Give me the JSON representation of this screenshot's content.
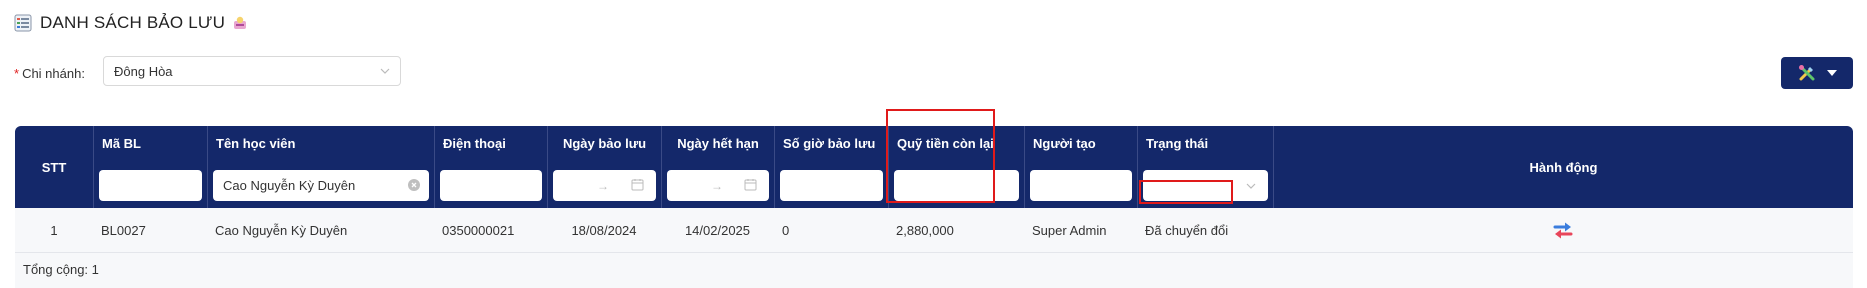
{
  "page": {
    "title": "DANH SÁCH BẢO LƯU"
  },
  "filter": {
    "required_mark": "*",
    "branch_label": "Chi nhánh:",
    "branch_value": "Đông Hòa"
  },
  "table": {
    "columns": {
      "stt": "STT",
      "code": "Mã BL",
      "student": "Tên học viên",
      "phone": "Điện thoại",
      "reserve_date": "Ngày bảo lưu",
      "expiry_date": "Ngày hết hạn",
      "hours": "Số giờ bảo lưu",
      "fund": "Quỹ tiền còn lại",
      "creator": "Người tạo",
      "status": "Trạng thái",
      "actions": "Hành động"
    },
    "filters": {
      "student_value": "Cao Nguyễn Kỳ Duyên",
      "date_separator": "→"
    },
    "rows": [
      {
        "stt": "1",
        "code": "BL0027",
        "student": "Cao Nguyễn Kỳ Duyên",
        "phone": "0350000021",
        "reserve_date": "18/08/2024",
        "expiry_date": "14/02/2025",
        "hours": "0",
        "fund": "2,880,000",
        "creator": "Super Admin",
        "status": "Đã chuyển đổi"
      }
    ],
    "total_label": "Tổng cộng: 1"
  },
  "icons": [
    "list-icon",
    "decorative-sticker-icon",
    "chevron-down-icon",
    "tools-icon",
    "caret-down-icon",
    "clear-icon",
    "calendar-icon",
    "transfer-icon"
  ],
  "colors": {
    "header_bg": "#14286a",
    "highlight": "#e01a1a",
    "required": "#e02020",
    "row_bg": "#f7f8fa"
  }
}
